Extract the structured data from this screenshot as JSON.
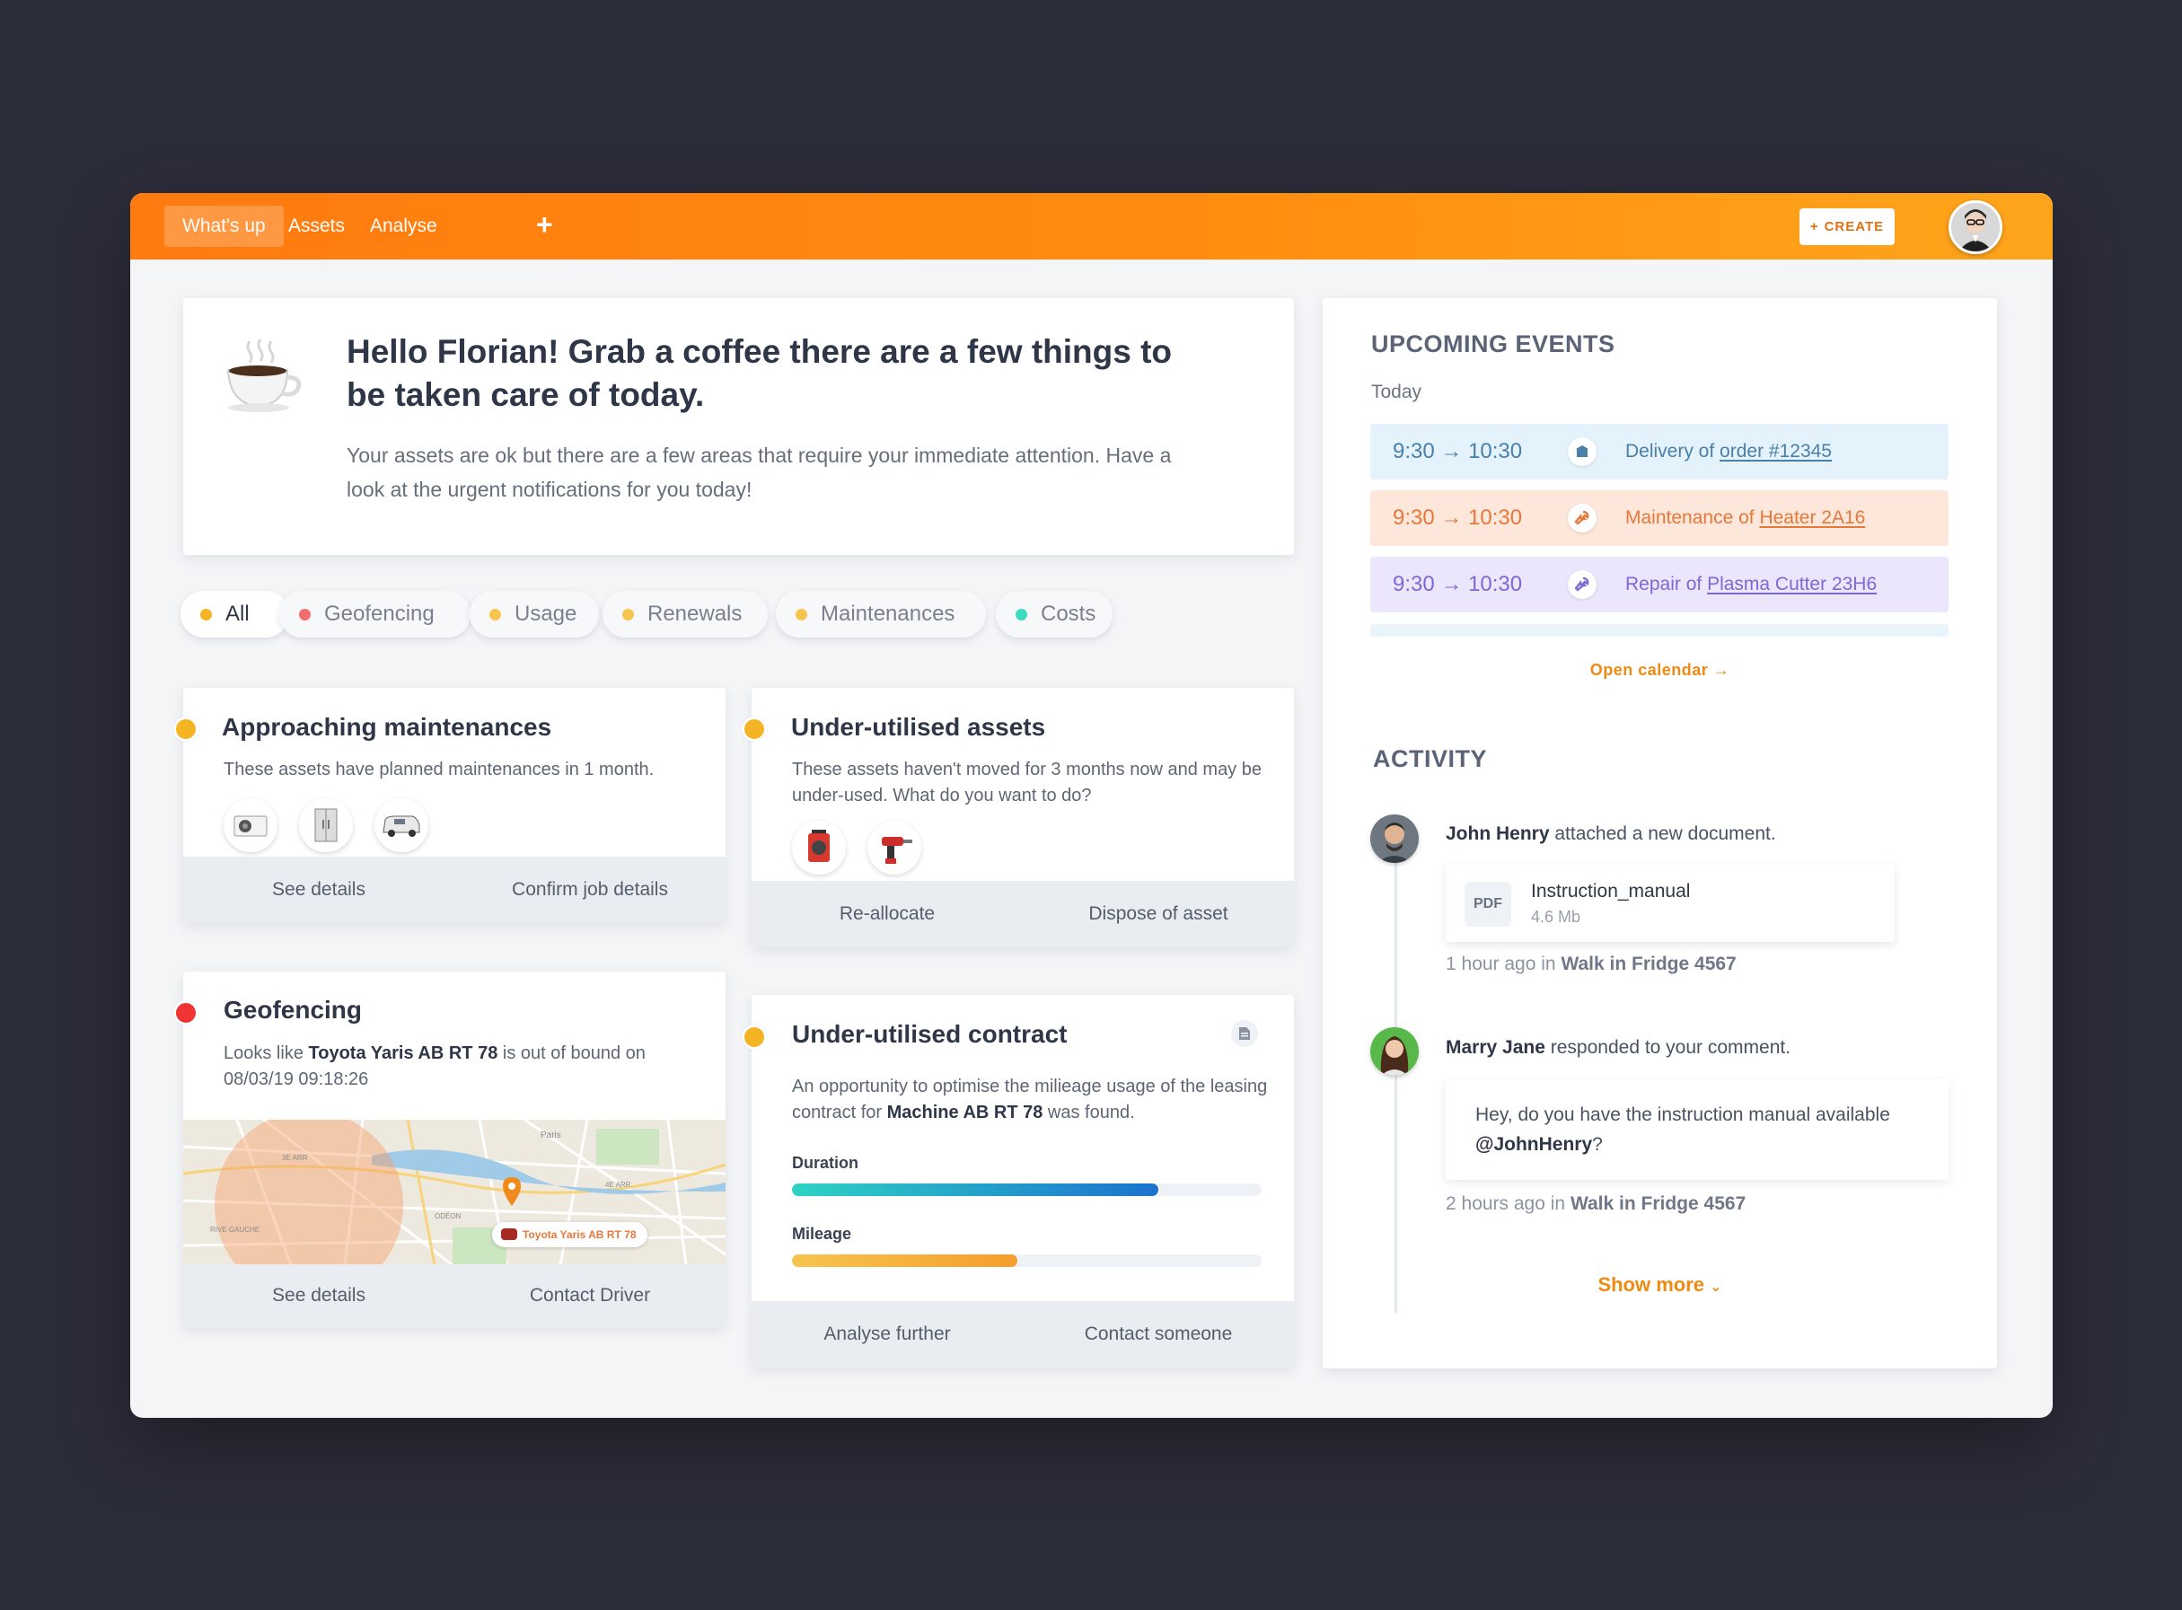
{
  "nav": {
    "tabs": [
      "What's up",
      "Assets",
      "Analyse"
    ],
    "plus": "+",
    "create_icon": "+",
    "create_label": "CREATE"
  },
  "hello": {
    "title": "Hello Florian! Grab a coffee there are a few things to be taken care of today.",
    "body": "Your assets are ok but there are a few areas that require your immediate attention. Have a look at the urgent notifications for you today!"
  },
  "filters": [
    {
      "label": "All",
      "color": "#f5b423"
    },
    {
      "label": "Geofencing",
      "color": "#f26d6d"
    },
    {
      "label": "Usage",
      "color": "#f6c54e"
    },
    {
      "label": "Renewals",
      "color": "#f6c54e"
    },
    {
      "label": "Maintenances",
      "color": "#f6c54e"
    },
    {
      "label": "Costs",
      "color": "#3ddbc2"
    }
  ],
  "cards": {
    "maint": {
      "title": "Approaching maintenances",
      "desc": "These assets have planned maintenances in 1 month.",
      "actions": [
        "See details",
        "Confirm job details"
      ]
    },
    "under_assets": {
      "title": "Under-utilised assets",
      "desc": "These assets haven't moved for 3 months now and may be under-used. What do you want to do?",
      "actions": [
        "Re-allocate",
        "Dispose of asset"
      ]
    },
    "geo": {
      "title": "Geofencing",
      "desc_pre": "Looks like",
      "desc_strong": "Toyota Yaris AB RT 78",
      "desc_post": " is out of bound on 08/03/19 09:18:26",
      "map_tag": "Toyota Yaris AB RT 78",
      "map_labels": [
        "Paris",
        "3E ARR",
        "4E ARR",
        "ODÉON",
        "RIVE GAUCHE"
      ],
      "actions": [
        "See details",
        "Contact Driver"
      ]
    },
    "contract": {
      "title": "Under-utilised contract",
      "desc_pre": "An opportunity to optimise the milieage usage of the leasing contract for",
      "desc_strong": "Machine AB RT 78",
      "desc_post": "was found.",
      "duration_label": "Duration",
      "duration_value": 0.78,
      "mileage_label": "Mileage",
      "mileage_value": 0.48,
      "actions": [
        "Analyse further",
        "Contact someone"
      ]
    }
  },
  "events": {
    "title": "UPCOMING EVENTS",
    "day": "Today",
    "items": [
      {
        "start": "9:30",
        "end": "10:30",
        "label": "Delivery of",
        "link": "order #12345",
        "icon": "box-icon",
        "bg": "#e4f3fb",
        "color": "#4a7fa8"
      },
      {
        "start": "9:30",
        "end": "10:30",
        "label": "Maintenance of",
        "link": "Heater 2A16",
        "icon": "wrench-icon",
        "bg": "#fde6da",
        "color": "#e7783a"
      },
      {
        "start": "9:30",
        "end": "10:30",
        "label": "Repair of",
        "link": "Plasma Cutter 23H6",
        "icon": "wrench-icon",
        "bg": "#ebe6fb",
        "color": "#7b69d4"
      }
    ],
    "open_calendar": "Open calendar"
  },
  "activity": {
    "title": "ACTIVITY",
    "entries": [
      {
        "name": "John Henry",
        "text": "attached a new document.",
        "doc_badge": "PDF",
        "doc_name": "Instruction_manual",
        "doc_size": "4.6 Mb",
        "time": "1 hour ago in",
        "place": "Walk in Fridge 4567"
      },
      {
        "name": "Marry Jane",
        "text": "responded to your comment.",
        "comment_pre": "Hey, do you have the instruction manual available",
        "comment_mention": "@JohnHenry",
        "comment_post": "?",
        "time": "2 hours ago in",
        "place": "Walk in Fridge 4567"
      }
    ],
    "show_more": "Show more"
  }
}
